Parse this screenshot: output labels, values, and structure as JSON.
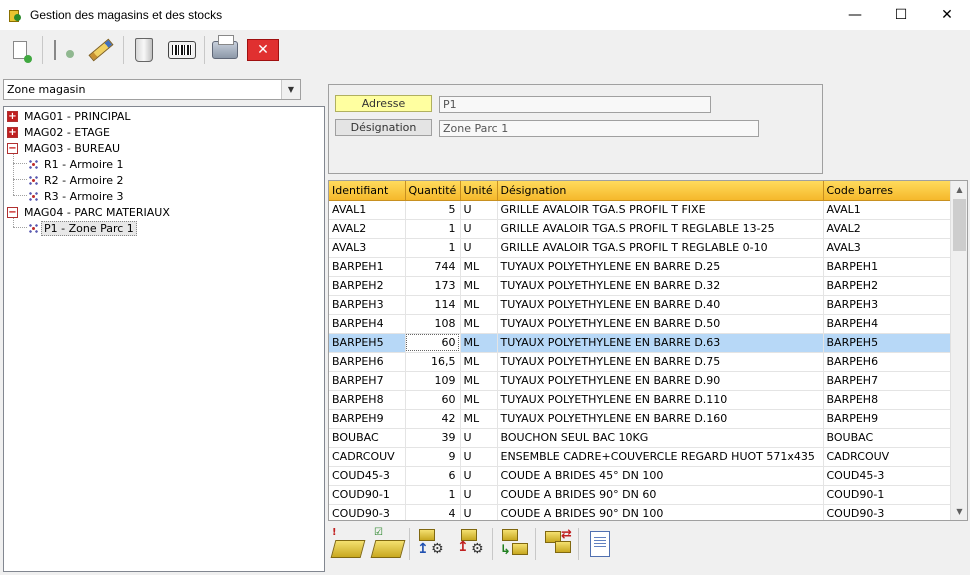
{
  "window": {
    "title": "Gestion des magasins et des stocks",
    "minimize": "—",
    "maximize": "☐",
    "close": "✕"
  },
  "toolbar": {
    "close_glyph": "✕"
  },
  "left": {
    "combo_value": "Zone magasin",
    "tree": [
      {
        "label": "MAG01 - PRINCIPAL",
        "expander": "+",
        "level": 0
      },
      {
        "label": "MAG02 - ETAGE",
        "expander": "+",
        "level": 0
      },
      {
        "label": "MAG03 - BUREAU",
        "expander": "−",
        "level": 0
      },
      {
        "label": "R1 - Armoire 1",
        "level": 1
      },
      {
        "label": "R2 - Armoire 2",
        "level": 1
      },
      {
        "label": "R3 - Armoire 3",
        "level": 1
      },
      {
        "label": "MAG04 - PARC MATERIAUX",
        "expander": "−",
        "level": 0
      },
      {
        "label": "P1 - Zone Parc 1",
        "level": 1,
        "selected": true
      }
    ]
  },
  "form": {
    "adresse_label": "Adresse",
    "adresse_value": "P1",
    "designation_label": "Désignation",
    "designation_value": "Zone Parc 1"
  },
  "grid": {
    "columns": [
      "Identifiant",
      "Quantité",
      "Unité",
      "Désignation",
      "Code barres"
    ],
    "rows": [
      [
        "AVAL1",
        "5",
        "U",
        "GRILLE AVALOIR TGA.S PROFIL T FIXE",
        "AVAL1"
      ],
      [
        "AVAL2",
        "1",
        "U",
        "GRILLE AVALOIR TGA.S PROFIL T REGLABLE 13-25",
        "AVAL2"
      ],
      [
        "AVAL3",
        "1",
        "U",
        "GRILLE AVALOIR TGA.S PROFIL T REGLABLE 0-10",
        "AVAL3"
      ],
      [
        "BARPEH1",
        "744",
        "ML",
        "TUYAUX POLYETHYLENE EN BARRE D.25",
        "BARPEH1"
      ],
      [
        "BARPEH2",
        "173",
        "ML",
        "TUYAUX POLYETHYLENE EN BARRE D.32",
        "BARPEH2"
      ],
      [
        "BARPEH3",
        "114",
        "ML",
        "TUYAUX POLYETHYLENE EN BARRE D.40",
        "BARPEH3"
      ],
      [
        "BARPEH4",
        "108",
        "ML",
        "TUYAUX POLYETHYLENE EN BARRE D.50",
        "BARPEH4"
      ],
      [
        "BARPEH5",
        "60",
        "ML",
        "TUYAUX POLYETHYLENE EN BARRE D.63",
        "BARPEH5"
      ],
      [
        "BARPEH6",
        "16,5",
        "ML",
        "TUYAUX POLYETHYLENE EN BARRE D.75",
        "BARPEH6"
      ],
      [
        "BARPEH7",
        "109",
        "ML",
        "TUYAUX POLYETHYLENE EN BARRE D.90",
        "BARPEH7"
      ],
      [
        "BARPEH8",
        "60",
        "ML",
        "TUYAUX POLYETHYLENE EN BARRE D.110",
        "BARPEH8"
      ],
      [
        "BARPEH9",
        "42",
        "ML",
        "TUYAUX POLYETHYLENE EN BARRE D.160",
        "BARPEH9"
      ],
      [
        "BOUBAC",
        "39",
        "U",
        "BOUCHON SEUL BAC 10KG",
        "BOUBAC"
      ],
      [
        "CADRCOUV",
        "9",
        "U",
        "ENSEMBLE CADRE+COUVERCLE REGARD HUOT 571x435",
        "CADRCOUV"
      ],
      [
        "COUD45-3",
        "6",
        "U",
        "COUDE A BRIDES 45° DN 100",
        "COUD45-3"
      ],
      [
        "COUD90-1",
        "1",
        "U",
        "COUDE A BRIDES 90° DN 60",
        "COUD90-1"
      ],
      [
        "COUD90-3",
        "4",
        "U",
        "COUDE A BRIDES 90° DN 100",
        "COUD90-3"
      ]
    ],
    "selected_row": 7
  },
  "colors": {
    "header_gradient_top": "#ffdb5c",
    "header_gradient_bottom": "#f5b82b",
    "selection": "#b7d8f7",
    "highlight_label": "#ffffa0"
  }
}
